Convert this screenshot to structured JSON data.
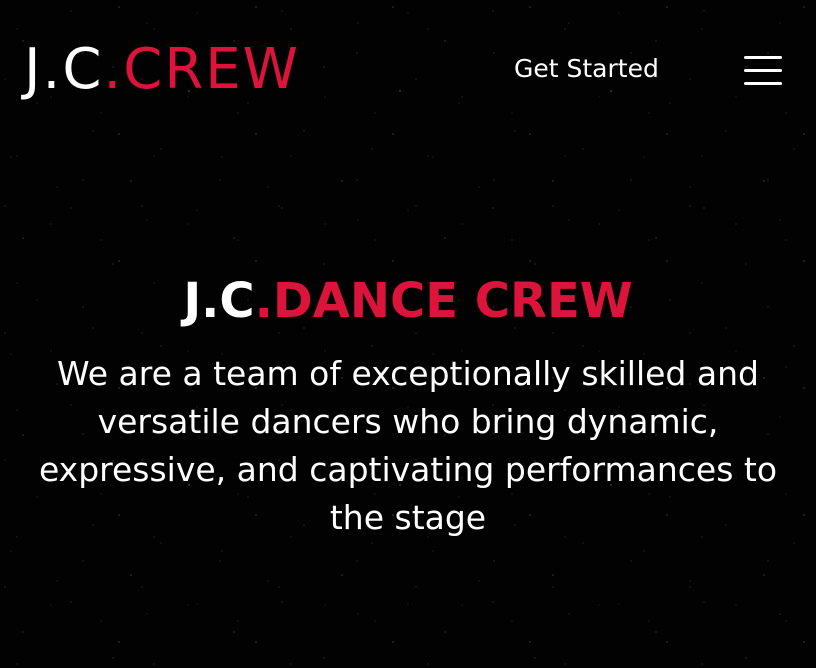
{
  "header": {
    "logo": {
      "part1": "J.C",
      "part2": ".CREW"
    },
    "get_started": "Get Started",
    "menu_icon": "hamburger-menu-icon"
  },
  "hero": {
    "title": {
      "part1": "J.C",
      "part2": ".DANCE CREW"
    },
    "description": "We are a team of exceptionally skilled and versatile dancers who bring dynamic, expressive, and captivating performances to the stage"
  },
  "colors": {
    "background": "#000000",
    "text": "#ffffff",
    "accent": "#dc143c"
  }
}
